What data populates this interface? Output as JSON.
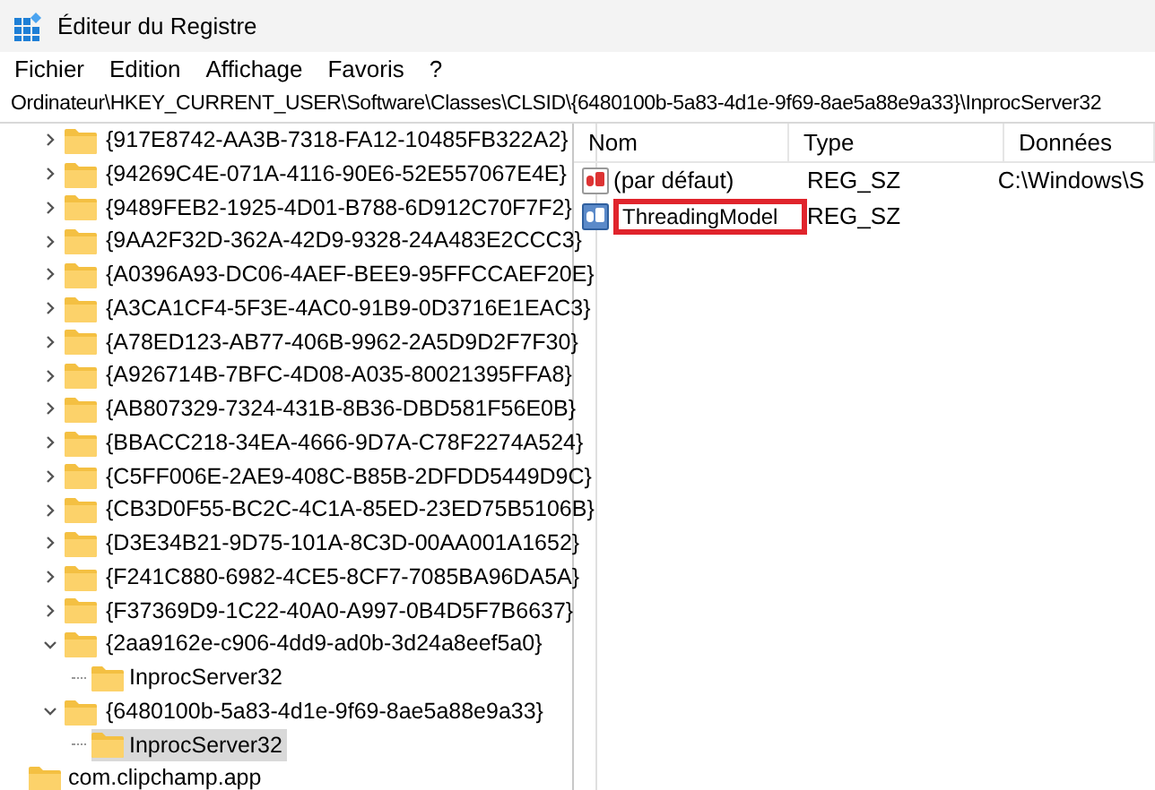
{
  "window": {
    "title": "Éditeur du Registre"
  },
  "menu": [
    "Fichier",
    "Edition",
    "Affichage",
    "Favoris",
    "?"
  ],
  "address": "Ordinateur\\HKEY_CURRENT_USER\\Software\\Classes\\CLSID\\{6480100b-5a83-4d1e-9f69-8ae5a88e9a33}\\InprocServer32",
  "tree": [
    {
      "label": "{917E8742-AA3B-7318-FA12-10485FB322A2}",
      "expanded": false,
      "selected": false
    },
    {
      "label": "{94269C4E-071A-4116-90E6-52E557067E4E}",
      "expanded": false,
      "selected": false
    },
    {
      "label": "{9489FEB2-1925-4D01-B788-6D912C70F7F2}",
      "expanded": false,
      "selected": false
    },
    {
      "label": "{9AA2F32D-362A-42D9-9328-24A483E2CCC3}",
      "expanded": false,
      "selected": false
    },
    {
      "label": "{A0396A93-DC06-4AEF-BEE9-95FFCCAEF20E}",
      "expanded": false,
      "selected": false
    },
    {
      "label": "{A3CA1CF4-5F3E-4AC0-91B9-0D3716E1EAC3}",
      "expanded": false,
      "selected": false
    },
    {
      "label": "{A78ED123-AB77-406B-9962-2A5D9D2F7F30}",
      "expanded": false,
      "selected": false
    },
    {
      "label": "{A926714B-7BFC-4D08-A035-80021395FFA8}",
      "expanded": false,
      "selected": false
    },
    {
      "label": "{AB807329-7324-431B-8B36-DBD581F56E0B}",
      "expanded": false,
      "selected": false
    },
    {
      "label": "{BBACC218-34EA-4666-9D7A-C78F2274A524}",
      "expanded": false,
      "selected": false
    },
    {
      "label": "{C5FF006E-2AE9-408C-B85B-2DFDD5449D9C}",
      "expanded": false,
      "selected": false
    },
    {
      "label": "{CB3D0F55-BC2C-4C1A-85ED-23ED75B5106B}",
      "expanded": false,
      "selected": false
    },
    {
      "label": "{D3E34B21-9D75-101A-8C3D-00AA001A1652}",
      "expanded": false,
      "selected": false
    },
    {
      "label": "{F241C880-6982-4CE5-8CF7-7085BA96DA5A}",
      "expanded": false,
      "selected": false
    },
    {
      "label": "{F37369D9-1C22-40A0-A997-0B4D5F7B6637}",
      "expanded": false,
      "selected": false
    },
    {
      "label": "{2aa9162e-c906-4dd9-ad0b-3d24a8eef5a0}",
      "expanded": true,
      "selected": false,
      "children": [
        {
          "label": "InprocServer32",
          "selected": false
        }
      ]
    },
    {
      "label": "{6480100b-5a83-4d1e-9f69-8ae5a88e9a33}",
      "expanded": true,
      "selected": false,
      "children": [
        {
          "label": "InprocServer32",
          "selected": true
        }
      ]
    }
  ],
  "tree_footer": {
    "label": "com.clipchamp.app"
  },
  "columns": [
    "Nom",
    "Type",
    "Données"
  ],
  "values": [
    {
      "name": "(par défaut)",
      "type": "REG_SZ",
      "data": "C:\\Windows\\S",
      "editing": false
    },
    {
      "name": "ThreadingModel",
      "type": "REG_SZ",
      "editing": true
    }
  ]
}
